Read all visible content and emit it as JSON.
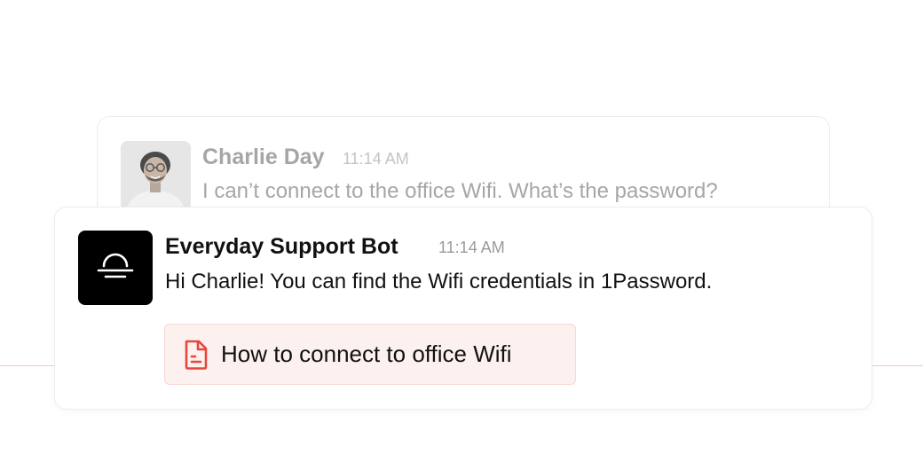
{
  "user_message": {
    "author": "Charlie Day",
    "time": "11:14 AM",
    "text": "I can’t connect to the office Wifi. What’s the password?"
  },
  "bot_message": {
    "author": "Everyday Support Bot",
    "time": "11:14 AM",
    "text": "Hi Charlie! You can find the Wifi credentials in 1Password.",
    "attachment": {
      "icon": "document-icon",
      "label": "How to connect to office Wifi"
    }
  },
  "colors": {
    "accent": "#e8463a",
    "attachment_bg": "#fdf1f0",
    "divider": "#f2c9c6"
  }
}
